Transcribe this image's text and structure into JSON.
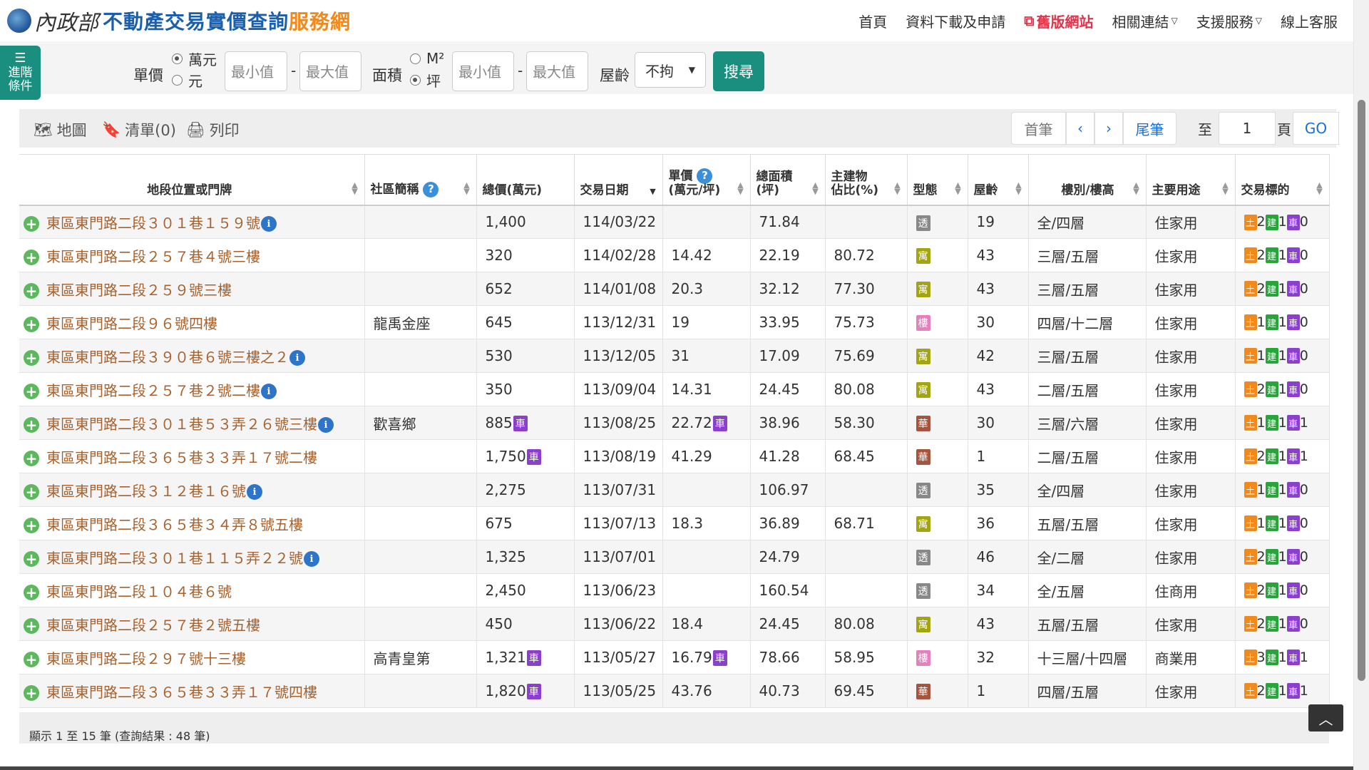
{
  "header": {
    "org": "內政部",
    "title": "不動產交易實價查詢",
    "title_suffix": "服務網",
    "nav": [
      {
        "label": "首頁"
      },
      {
        "label": "資料下載及申請"
      },
      {
        "label": "舊版網站"
      },
      {
        "label": "相關連結"
      },
      {
        "label": "支援服務"
      },
      {
        "label": "線上客服"
      }
    ]
  },
  "advanced_button": {
    "label": "進階條件"
  },
  "filters": {
    "unit_price_label": "單價",
    "unit_price_options": [
      "萬元",
      "元"
    ],
    "unit_price_selected": "萬元",
    "min_placeholder": "最小值",
    "max_placeholder": "最大值",
    "dash": "-",
    "area_label": "面積",
    "area_options": [
      "M²",
      "坪"
    ],
    "area_selected": "坪",
    "age_label": "屋齡",
    "age_value": "不拘",
    "search_label": "搜尋"
  },
  "toolbar": {
    "map": "地圖",
    "list": "清單(0)",
    "print": "列印",
    "first": "首筆",
    "prev": "‹",
    "next": "›",
    "last": "尾筆",
    "to": "至",
    "page_value": "1",
    "page": "頁",
    "go": "GO"
  },
  "table": {
    "columns": [
      {
        "label": "地段位置或門牌"
      },
      {
        "label": "社區簡稱"
      },
      {
        "label": "總價(萬元)"
      },
      {
        "label": "交易日期"
      },
      {
        "label": "單價",
        "label2": "(萬元/坪)"
      },
      {
        "label": "總面積",
        "label2": "(坪)"
      },
      {
        "label": "主建物",
        "label2": "佔比(%)"
      },
      {
        "label": "型態"
      },
      {
        "label": "屋齡"
      },
      {
        "label": "樓別/樓高"
      },
      {
        "label": "主要用途"
      },
      {
        "label": "交易標的"
      }
    ],
    "rows": [
      {
        "address": "東區東門路二段３０１巷１５９號",
        "info": true,
        "community": "",
        "total": "1,400",
        "total_car": false,
        "date": "114/03/22",
        "unit": "",
        "unit_car": false,
        "area": "71.84",
        "ratio": "",
        "type": "透",
        "type_color": "#888888",
        "age": "19",
        "floor": "全/四層",
        "use": "住家用",
        "land": "2",
        "bldg": "1",
        "car": "0"
      },
      {
        "address": "東區東門路二段２５７巷４號三樓",
        "info": false,
        "community": "",
        "total": "320",
        "total_car": false,
        "date": "114/02/28",
        "unit": "14.42",
        "unit_car": false,
        "area": "22.19",
        "ratio": "80.72",
        "type": "寓",
        "type_color": "#a3a413",
        "age": "43",
        "floor": "三層/五層",
        "use": "住家用",
        "land": "2",
        "bldg": "1",
        "car": "0"
      },
      {
        "address": "東區東門路二段２５９號三樓",
        "info": false,
        "community": "",
        "total": "652",
        "total_car": false,
        "date": "114/01/08",
        "unit": "20.3",
        "unit_car": false,
        "area": "32.12",
        "ratio": "77.30",
        "type": "寓",
        "type_color": "#a3a413",
        "age": "43",
        "floor": "三層/五層",
        "use": "住家用",
        "land": "2",
        "bldg": "1",
        "car": "0"
      },
      {
        "address": "東區東門路二段９６號四樓",
        "info": false,
        "community": "龍禹金座",
        "total": "645",
        "total_car": false,
        "date": "113/12/31",
        "unit": "19",
        "unit_car": false,
        "area": "33.95",
        "ratio": "75.73",
        "type": "樓",
        "type_color": "#e77fbf",
        "age": "30",
        "floor": "四層/十二層",
        "use": "住家用",
        "land": "1",
        "bldg": "1",
        "car": "0"
      },
      {
        "address": "東區東門路二段３９０巷６號三樓之２",
        "info": true,
        "community": "",
        "total": "530",
        "total_car": false,
        "date": "113/12/05",
        "unit": "31",
        "unit_car": false,
        "area": "17.09",
        "ratio": "75.69",
        "type": "寓",
        "type_color": "#a3a413",
        "age": "42",
        "floor": "三層/五層",
        "use": "住家用",
        "land": "1",
        "bldg": "1",
        "car": "0"
      },
      {
        "address": "東區東門路二段２５７巷２號二樓",
        "info": true,
        "community": "",
        "total": "350",
        "total_car": false,
        "date": "113/09/04",
        "unit": "14.31",
        "unit_car": false,
        "area": "24.45",
        "ratio": "80.08",
        "type": "寓",
        "type_color": "#a3a413",
        "age": "43",
        "floor": "二層/五層",
        "use": "住家用",
        "land": "2",
        "bldg": "1",
        "car": "0"
      },
      {
        "address": "東區東門路二段３０１巷５３弄２６號三樓",
        "info": true,
        "community": "歡喜鄉",
        "total": "885",
        "total_car": true,
        "date": "113/08/25",
        "unit": "22.72",
        "unit_car": true,
        "area": "38.96",
        "ratio": "58.30",
        "type": "華",
        "type_color": "#a5543e",
        "age": "30",
        "floor": "三層/六層",
        "use": "住家用",
        "land": "1",
        "bldg": "1",
        "car": "1"
      },
      {
        "address": "東區東門路二段３６５巷３３弄１７號二樓",
        "info": false,
        "community": "",
        "total": "1,750",
        "total_car": true,
        "date": "113/08/19",
        "unit": "41.29",
        "unit_car": false,
        "area": "41.28",
        "ratio": "68.45",
        "type": "華",
        "type_color": "#a5543e",
        "age": "1",
        "floor": "二層/五層",
        "use": "住家用",
        "land": "2",
        "bldg": "1",
        "car": "1"
      },
      {
        "address": "東區東門路二段３１２巷１６號",
        "info": true,
        "community": "",
        "total": "2,275",
        "total_car": false,
        "date": "113/07/31",
        "unit": "",
        "unit_car": false,
        "area": "106.97",
        "ratio": "",
        "type": "透",
        "type_color": "#888888",
        "age": "35",
        "floor": "全/四層",
        "use": "住家用",
        "land": "1",
        "bldg": "1",
        "car": "0"
      },
      {
        "address": "東區東門路二段３６５巷３４弄８號五樓",
        "info": false,
        "community": "",
        "total": "675",
        "total_car": false,
        "date": "113/07/13",
        "unit": "18.3",
        "unit_car": false,
        "area": "36.89",
        "ratio": "68.71",
        "type": "寓",
        "type_color": "#a3a413",
        "age": "36",
        "floor": "五層/五層",
        "use": "住家用",
        "land": "1",
        "bldg": "1",
        "car": "0"
      },
      {
        "address": "東區東門路二段３０１巷１１５弄２２號",
        "info": true,
        "community": "",
        "total": "1,325",
        "total_car": false,
        "date": "113/07/01",
        "unit": "",
        "unit_car": false,
        "area": "24.79",
        "ratio": "",
        "type": "透",
        "type_color": "#888888",
        "age": "46",
        "floor": "全/二層",
        "use": "住家用",
        "land": "2",
        "bldg": "1",
        "car": "0"
      },
      {
        "address": "東區東門路二段１０４巷６號",
        "info": false,
        "community": "",
        "total": "2,450",
        "total_car": false,
        "date": "113/06/23",
        "unit": "",
        "unit_car": false,
        "area": "160.54",
        "ratio": "",
        "type": "透",
        "type_color": "#888888",
        "age": "34",
        "floor": "全/五層",
        "use": "住商用",
        "land": "2",
        "bldg": "1",
        "car": "0"
      },
      {
        "address": "東區東門路二段２５７巷２號五樓",
        "info": false,
        "community": "",
        "total": "450",
        "total_car": false,
        "date": "113/06/22",
        "unit": "18.4",
        "unit_car": false,
        "area": "24.45",
        "ratio": "80.08",
        "type": "寓",
        "type_color": "#a3a413",
        "age": "43",
        "floor": "五層/五層",
        "use": "住家用",
        "land": "2",
        "bldg": "1",
        "car": "0"
      },
      {
        "address": "東區東門路二段２９７號十三樓",
        "info": false,
        "community": "高青皇第",
        "total": "1,321",
        "total_car": true,
        "date": "113/05/27",
        "unit": "16.79",
        "unit_car": true,
        "area": "78.66",
        "ratio": "58.95",
        "type": "樓",
        "type_color": "#e77fbf",
        "age": "32",
        "floor": "十三層/十四層",
        "use": "商業用",
        "land": "3",
        "bldg": "1",
        "car": "1"
      },
      {
        "address": "東區東門路二段３６５巷３３弄１７號四樓",
        "info": false,
        "community": "",
        "total": "1,820",
        "total_car": true,
        "date": "113/05/25",
        "unit": "43.76",
        "unit_car": false,
        "area": "40.73",
        "ratio": "69.45",
        "type": "華",
        "type_color": "#a5543e",
        "age": "1",
        "floor": "四層/五層",
        "use": "住家用",
        "land": "2",
        "bldg": "1",
        "car": "1"
      }
    ],
    "badges": {
      "land": "土",
      "bldg": "建",
      "car": "車"
    }
  },
  "footer": {
    "text": "顯示 1 至 15 筆 (查詢結果 : 48 筆)"
  },
  "colors": {
    "brand_blue": "#1b5fab",
    "brand_orange": "#f08a1c",
    "accent_green": "#1a8f80",
    "address_brown": "#a8612d"
  }
}
